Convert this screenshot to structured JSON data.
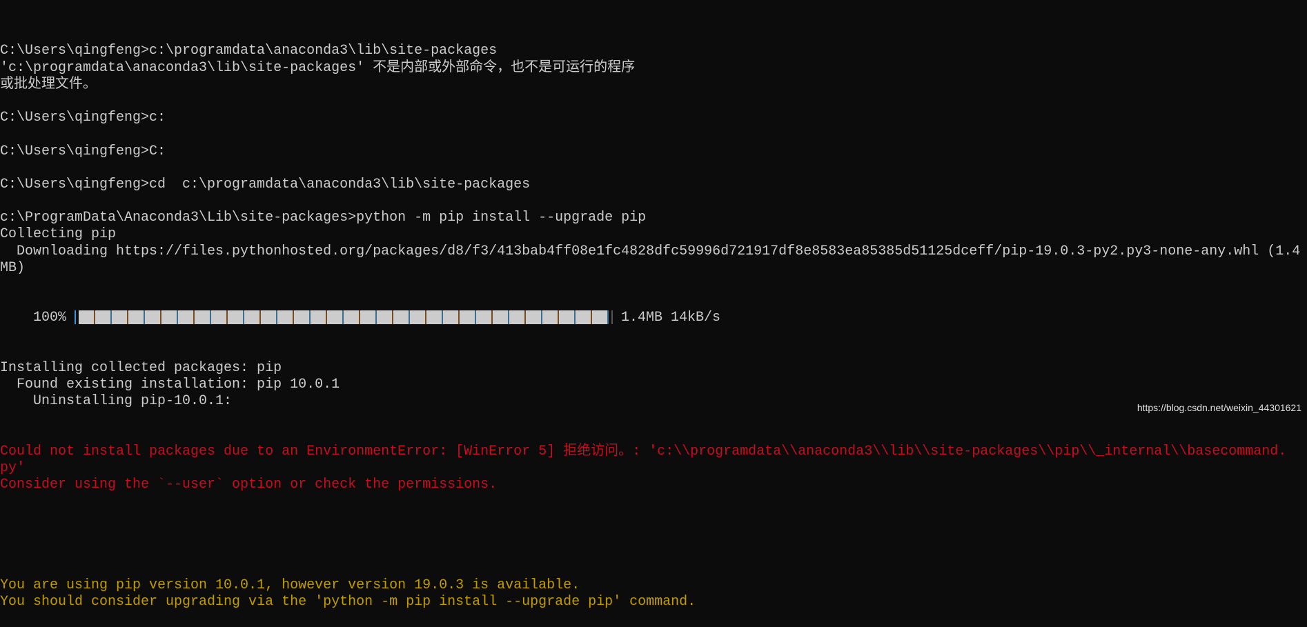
{
  "colors": {
    "background": "#0c0c0c",
    "text": "#cccccc",
    "error": "#c50f1f",
    "warning": "#c19c00"
  },
  "lines": [
    "C:\\Users\\qingfeng>c:\\programdata\\anaconda3\\lib\\site-packages",
    "'c:\\programdata\\anaconda3\\lib\\site-packages' 不是内部或外部命令，也不是可运行的程序",
    "或批处理文件。",
    "",
    "C:\\Users\\qingfeng>c:",
    "",
    "C:\\Users\\qingfeng>C:",
    "",
    "C:\\Users\\qingfeng>cd  c:\\programdata\\anaconda3\\lib\\site-packages",
    "",
    "c:\\ProgramData\\Anaconda3\\Lib\\site-packages>python -m pip install --upgrade pip",
    "Collecting pip",
    "  Downloading https://files.pythonhosted.org/packages/d8/f3/413bab4ff08e1fc4828dfc59996d721917df8e8583ea85385d51125dceff/pip-19.0.3-py2.py3-none-any.whl (1.4",
    "MB)"
  ],
  "progress": {
    "percent_label": "    100% ",
    "percent": 100,
    "info": " 1.4MB 14kB/s"
  },
  "lines2": [
    "Installing collected packages: pip",
    "  Found existing installation: pip 10.0.1",
    "    Uninstalling pip-10.0.1:"
  ],
  "errors": [
    "Could not install packages due to an EnvironmentError: [WinError 5] 拒绝访问。: 'c:\\\\programdata\\\\anaconda3\\\\lib\\\\site-packages\\\\pip\\\\_internal\\\\basecommand.",
    "py'",
    "Consider using the `--user` option or check the permissions."
  ],
  "warnings": [
    "You are using pip version 10.0.1, however version 19.0.3 is available.",
    "You should consider upgrading via the 'python -m pip install --upgrade pip' command."
  ],
  "watermark": "https://blog.csdn.net/weixin_44301621"
}
